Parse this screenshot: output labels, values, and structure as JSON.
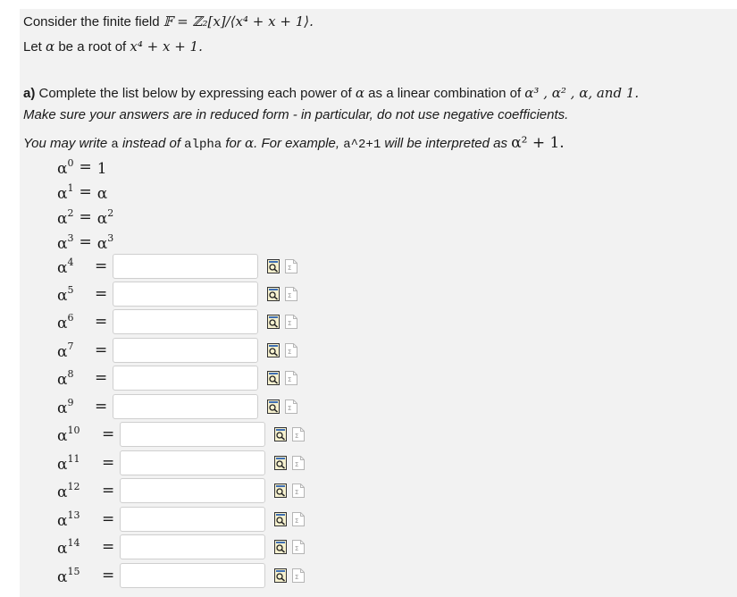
{
  "intro": {
    "line1_prefix": "Consider the finite field ",
    "field_expr": "𝔽 = ℤ₂[x]/⟨x⁴ + x + 1⟩.",
    "line2_prefix": "Let ",
    "line2_alpha": "α",
    "line2_middle": " be a root of ",
    "line2_poly": "x⁴ + x + 1."
  },
  "part_a": {
    "label": "a)",
    "instruction": " Complete the list below by expressing each power of ",
    "alpha": "α",
    "instruction_mid": " as a linear combination of ",
    "basis": "α³ , α² , α, and 1.",
    "reduced_note": "Make sure your answers are in reduced form - in particular, do not use negative coefficients.",
    "write_1": "You may write ",
    "code_a": "a",
    "write_2": " instead of ",
    "code_alpha": "alpha",
    "write_3": " for ",
    "write_alpha": "α",
    "write_4": ". For example, ",
    "code_example": "a^2+1",
    "write_5": " will be interpreted as ",
    "example_math": "α² + 1."
  },
  "known_rows": [
    {
      "base": "α",
      "exp": "0",
      "eq": "=",
      "rhs_base": "1",
      "rhs_exp": ""
    },
    {
      "base": "α",
      "exp": "1",
      "eq": "=",
      "rhs_base": "α",
      "rhs_exp": ""
    },
    {
      "base": "α",
      "exp": "2",
      "eq": "=",
      "rhs_base": "α",
      "rhs_exp": "2"
    },
    {
      "base": "α",
      "exp": "3",
      "eq": "=",
      "rhs_base": "α",
      "rhs_exp": "3"
    }
  ],
  "input_rows": [
    {
      "base": "α",
      "exp": "4",
      "eq": "=",
      "value": ""
    },
    {
      "base": "α",
      "exp": "5",
      "eq": "=",
      "value": ""
    },
    {
      "base": "α",
      "exp": "6",
      "eq": "=",
      "value": ""
    },
    {
      "base": "α",
      "exp": "7",
      "eq": "=",
      "value": ""
    },
    {
      "base": "α",
      "exp": "8",
      "eq": "=",
      "value": ""
    },
    {
      "base": "α",
      "exp": "9",
      "eq": "=",
      "value": ""
    },
    {
      "base": "α",
      "exp": "10",
      "eq": "=",
      "value": ""
    },
    {
      "base": "α",
      "exp": "11",
      "eq": "=",
      "value": ""
    },
    {
      "base": "α",
      "exp": "12",
      "eq": "=",
      "value": ""
    },
    {
      "base": "α",
      "exp": "13",
      "eq": "=",
      "value": ""
    },
    {
      "base": "α",
      "exp": "14",
      "eq": "=",
      "value": ""
    },
    {
      "base": "α",
      "exp": "15",
      "eq": "=",
      "value": ""
    }
  ],
  "icons": {
    "preview": "preview-answer-icon",
    "equation_editor": "equation-editor-icon"
  }
}
